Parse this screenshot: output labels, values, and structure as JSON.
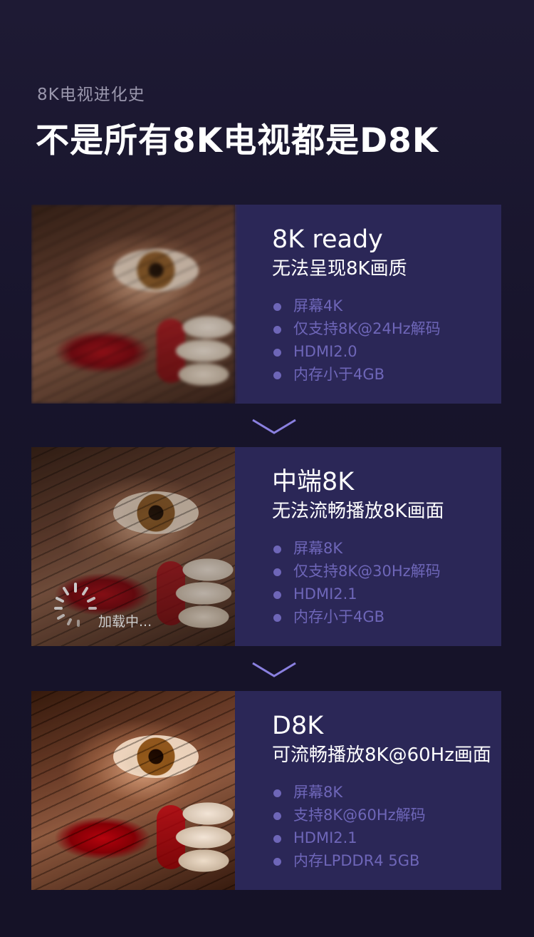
{
  "header": {
    "subtitle": "8K电视进化史",
    "title": "不是所有8K电视都是D8K"
  },
  "cards": [
    {
      "title": "8K ready",
      "description": "无法呈现8K画质",
      "features": [
        "屏幕4K",
        "仅支持8K@24Hz解码",
        "HDMI2.0",
        "内存小于4GB"
      ]
    },
    {
      "title": "中端8K",
      "description": "无法流畅播放8K画面",
      "features": [
        "屏幕8K",
        "仅支持8K@30Hz解码",
        "HDMI2.1",
        "内存小于4GB"
      ],
      "loading_text": "加载中..."
    },
    {
      "title": "D8K",
      "description": "可流畅播放8K@60Hz画面",
      "features": [
        "屏幕8K",
        "支持8K@60Hz解码",
        "HDMI2.1",
        "内存LPDDR4 5GB"
      ]
    }
  ],
  "icons": {
    "chevron": "chevron-down-icon",
    "loader": "loading-spinner-icon"
  },
  "colors": {
    "background": "#1a1730",
    "card_panel": "#2b2757",
    "feature_text": "#6e66b8",
    "chevron": "#8a80e0"
  }
}
